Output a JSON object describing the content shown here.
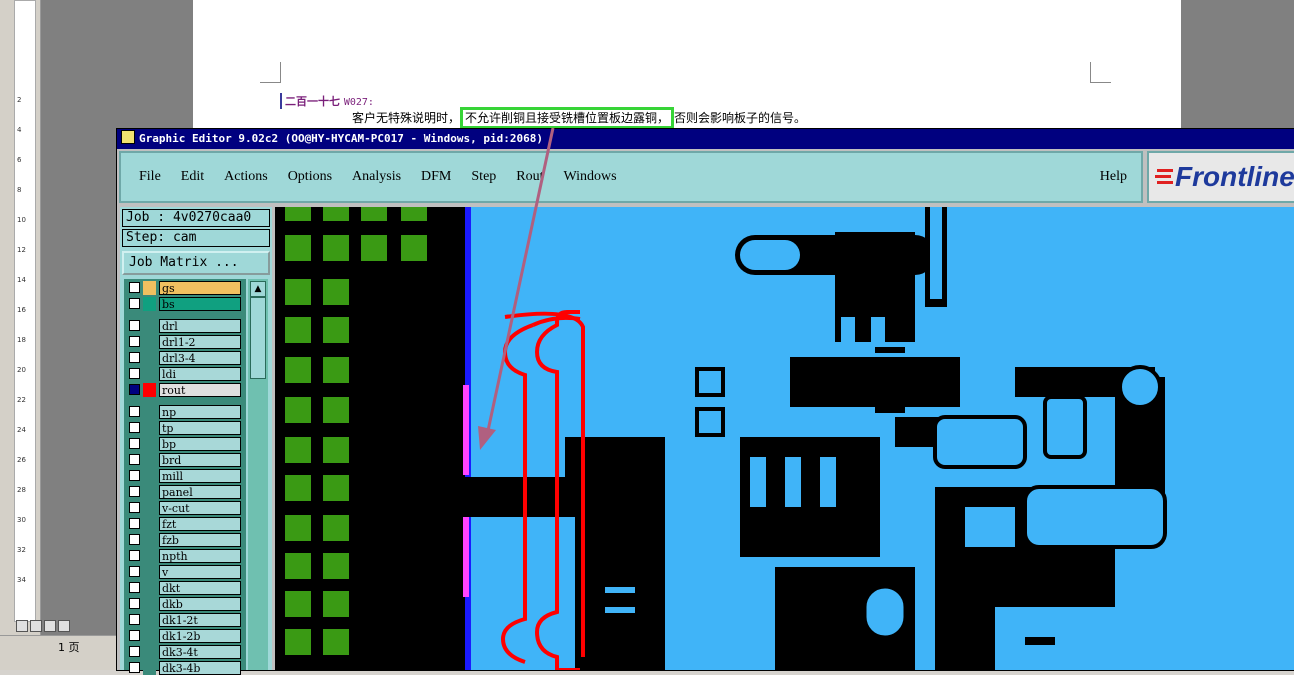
{
  "word": {
    "ruler_numbers": [
      "2",
      "4",
      "6",
      "8",
      "10",
      "12",
      "14",
      "16",
      "18",
      "20",
      "22",
      "24",
      "26",
      "28",
      "30",
      "32",
      "34"
    ],
    "page_indicator": "1 页",
    "heading_text": "二百一十七",
    "heading_code": "W027:",
    "para_before": "客户无特殊说明时，",
    "para_highlight": "不允许削铜且接受铣槽位置板边露铜，",
    "para_after": "否则会影响板子的信号。",
    "highlight_color": "#37d437"
  },
  "window": {
    "title": "Graphic Editor 9.02c2 (OO@HY-HYCAM-PC017 - Windows, pid:2068)",
    "menus": [
      "File",
      "Edit",
      "Actions",
      "Options",
      "Analysis",
      "DFM",
      "Step",
      "Rout",
      "Windows"
    ],
    "help": "Help",
    "logo": "Frontline"
  },
  "panel": {
    "job": "Job : 4v0270caa0",
    "step": "Step: cam",
    "matrix_button": "Job Matrix ...",
    "layers": [
      {
        "name": "gs",
        "color": "#f0c060"
      },
      {
        "name": "bs",
        "color": "#10a080"
      },
      {
        "name": "drl",
        "color": ""
      },
      {
        "name": "drl1-2",
        "color": ""
      },
      {
        "name": "drl3-4",
        "color": ""
      },
      {
        "name": "ldi",
        "color": ""
      },
      {
        "name": "rout",
        "color": "#ff0000",
        "active": true
      },
      {
        "name": "np",
        "color": ""
      },
      {
        "name": "tp",
        "color": ""
      },
      {
        "name": "bp",
        "color": ""
      },
      {
        "name": "brd",
        "color": ""
      },
      {
        "name": "mill",
        "color": ""
      },
      {
        "name": "panel",
        "color": ""
      },
      {
        "name": "v-cut",
        "color": ""
      },
      {
        "name": "fzt",
        "color": ""
      },
      {
        "name": "fzb",
        "color": ""
      },
      {
        "name": "npth",
        "color": ""
      },
      {
        "name": "v",
        "color": ""
      },
      {
        "name": "dkt",
        "color": ""
      },
      {
        "name": "dkb",
        "color": ""
      },
      {
        "name": "dk1-2t",
        "color": ""
      },
      {
        "name": "dk1-2b",
        "color": ""
      },
      {
        "name": "dk3-4t",
        "color": ""
      },
      {
        "name": "dk3-4b",
        "color": ""
      }
    ]
  },
  "colors": {
    "board_background": "#40b4f8",
    "copper": "#000000",
    "pads": "#3a9a14",
    "rout_outline": "#ff0000",
    "annotation_arrow": "#b06080"
  }
}
